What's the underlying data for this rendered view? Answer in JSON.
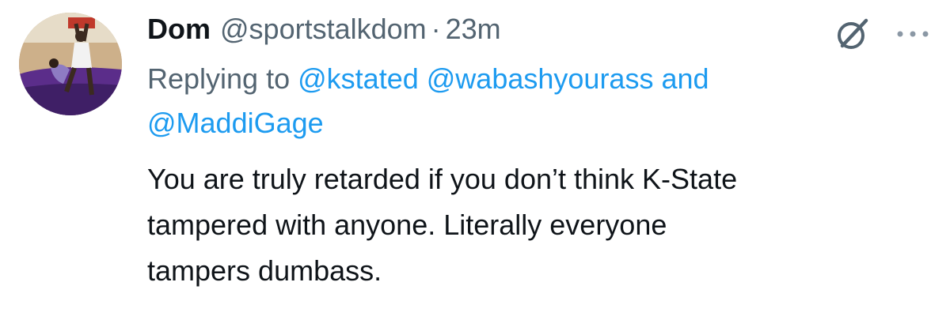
{
  "tweet": {
    "author": {
      "name": "Dom",
      "handle": "@sportstalkdom",
      "separator": "·",
      "time": "23m"
    },
    "reply": {
      "prefix": "Replying to",
      "mentions": [
        "@kstated",
        "@wabashyourass",
        "@MaddiGage"
      ],
      "conjunction": "and"
    },
    "lines": [
      "You are truly retarded if you don’t think K-State",
      "tampered with anyone. Literally everyone",
      "tampers dumbass."
    ],
    "icons": {
      "grok": "grok-icon",
      "more": "more-icon",
      "avatar": "avatar"
    },
    "colors": {
      "link": "#1d9bf0",
      "secondary": "#536471",
      "primary": "#0f1419"
    }
  }
}
